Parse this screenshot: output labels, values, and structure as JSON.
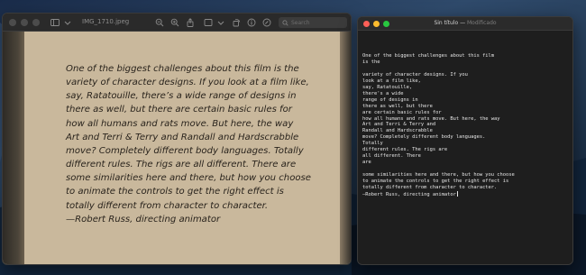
{
  "preview": {
    "file_name": "IMG_1710.jpeg",
    "search_placeholder": "Search",
    "quote_lines": [
      "One of the biggest challenges about this film is the",
      "variety of character designs. If you look at a film like,",
      "say, Ratatouille, there’s a wide range of designs in",
      "there as well, but there are certain basic rules for",
      "how all humans and rats move. But here, the way",
      "Art and Terri & Terry and Randall and Hardscrabble",
      "move? Completely different body languages. Totally",
      "different rules. The rigs are all different. There are",
      "some similarities here and there, but how you choose",
      "to animate the controls to get the right effect is",
      "totally different from character to character.",
      "—Robert Russ, directing animator"
    ]
  },
  "editor": {
    "title": "Sin título",
    "status": "Modificado",
    "lines": [
      "One of the biggest challenges about this film",
      "is the",
      "",
      "variety of character designs. If you",
      "look at a film like,",
      "say, Ratatouille,",
      "there's a wide",
      "range of designs in",
      "there as well, but there",
      "are certain basic rules for",
      "how all humans and rats move. But here, the way",
      "Art and Terri & Terry and",
      "Randall and Hardscrabble",
      "move? Completely different body languages.",
      "Totally",
      "different rules. The rigs are",
      "all different. There",
      "are",
      "",
      "some similarities here and there, but how you choose",
      "to animate the controls to get the right effect is",
      "totally different from character to character.",
      "—Robert Russ, directing animator"
    ]
  },
  "colors": {
    "close": "#fe5f57",
    "minimize": "#febc2e",
    "zoom": "#28c840",
    "paper": "#c9b89c",
    "ink": "#2a241d"
  }
}
